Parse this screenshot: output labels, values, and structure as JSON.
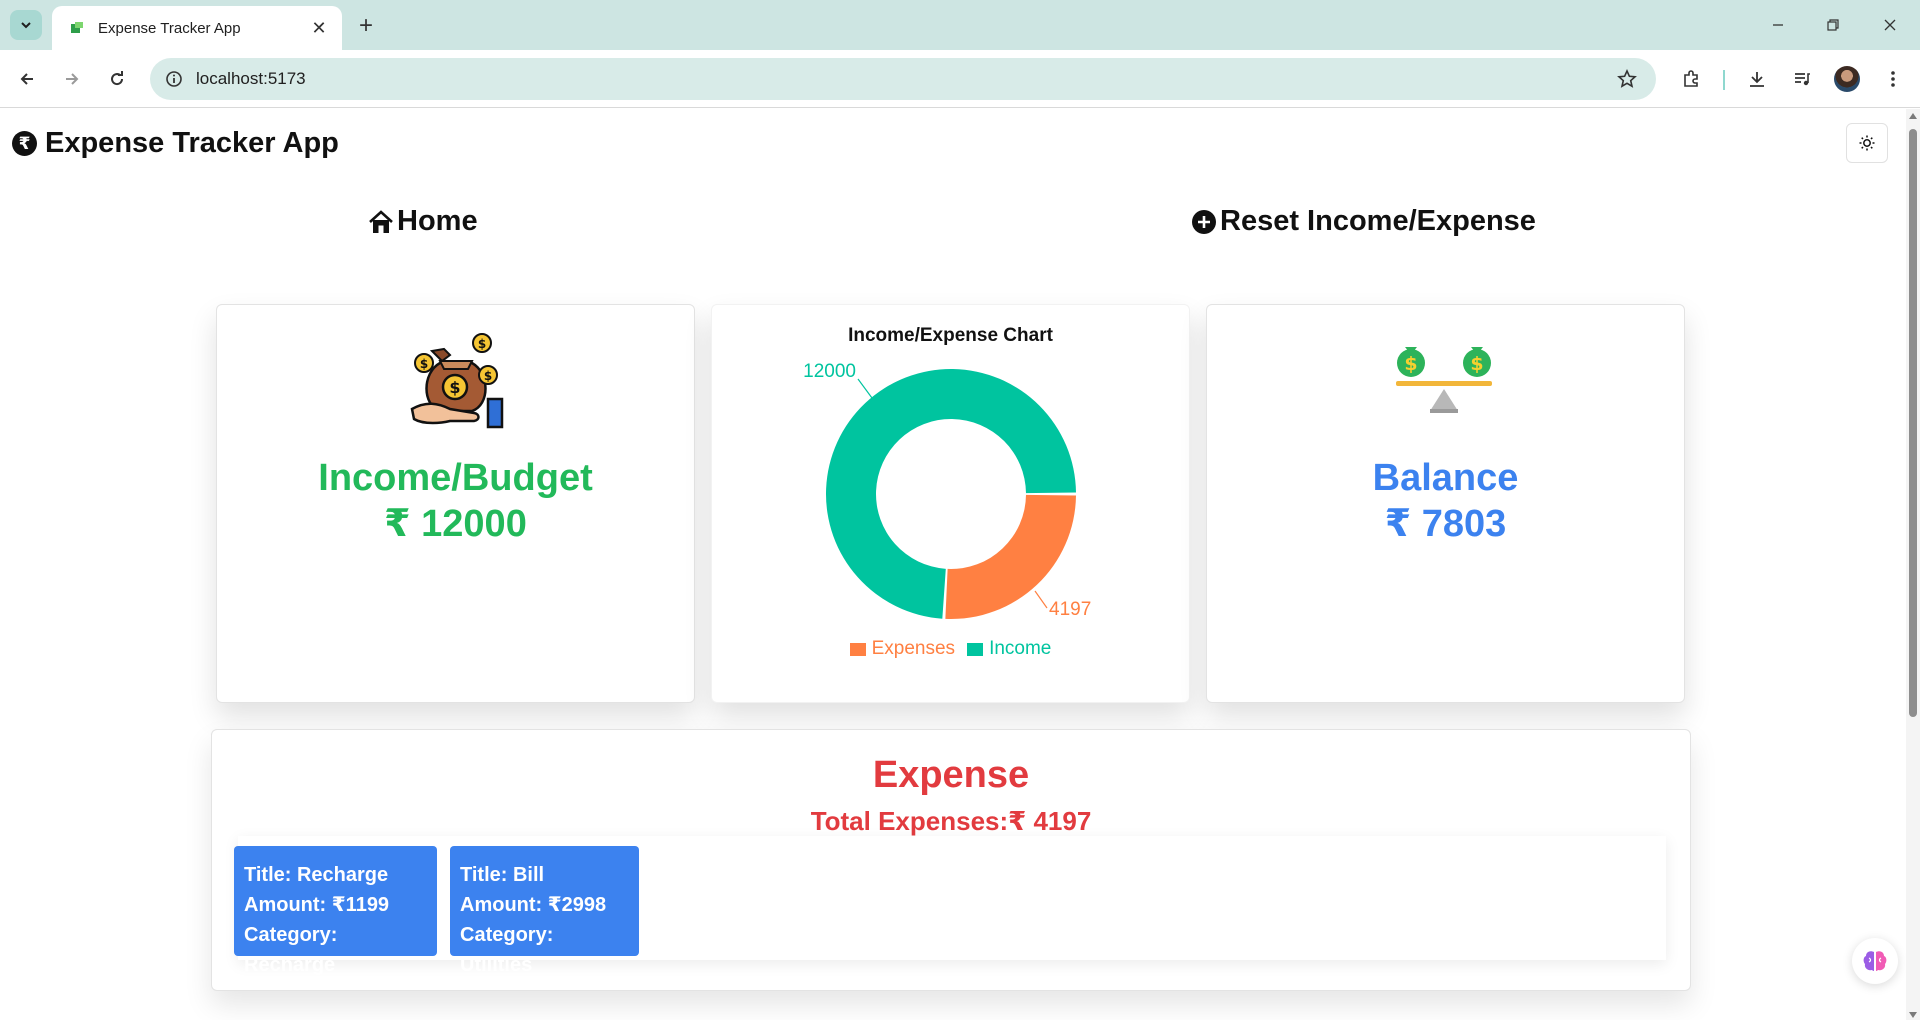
{
  "browser": {
    "tab_title": "Expense Tracker App",
    "url": "localhost:5173"
  },
  "app": {
    "title": "Expense Tracker App",
    "nav": {
      "home": "Home",
      "reset": "Reset Income/Expense"
    }
  },
  "income_card": {
    "label": "Income/Budget",
    "value": "₹ 12000",
    "color": "#22b95a"
  },
  "chart": {
    "title": "Income/Expense Chart",
    "expenses_label": "4197",
    "income_label": "12000",
    "legend": [
      "Expenses",
      "Income"
    ]
  },
  "chart_data": {
    "type": "pie",
    "title": "Income/Expense Chart",
    "categories": [
      "Expenses",
      "Income"
    ],
    "values": [
      4197,
      12000
    ],
    "colors": [
      "#ff8042",
      "#00c49f"
    ],
    "donut": true,
    "legend": "bottom"
  },
  "balance_card": {
    "label": "Balance",
    "value": "₹ 7803",
    "color": "#3c82ef"
  },
  "expense": {
    "heading": "Expense",
    "total": "Total Expenses:₹ 4197",
    "items": [
      {
        "title": "Title: Recharge",
        "amount": "Amount: ₹1199",
        "category": "Category: Recharge"
      },
      {
        "title": "Title: Bill",
        "amount": "Amount: ₹2998",
        "category": "Category: Utilities"
      }
    ]
  }
}
